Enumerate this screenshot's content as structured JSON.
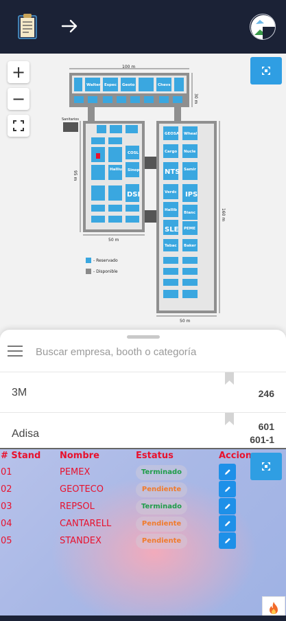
{
  "header": {
    "avatar_alt": ""
  },
  "map": {
    "plan": {
      "top_width": "100 m",
      "top_height": "30 m",
      "left_width": "50 m",
      "left_height": "95 m",
      "right_width": "50 m",
      "right_height": "160 m",
      "sanitarios": "Sanitarios",
      "legend_reservado": "- Reservado",
      "legend_disponible": "- Disponible",
      "top_labels": [
        "Walter",
        "Espec",
        "Geoto",
        "Chevs"
      ],
      "left_labels": [
        "COSL",
        "Halliu",
        "Sinop",
        "DSI"
      ],
      "right_labels": [
        "GEOSA",
        "Wheal",
        "Cargo",
        "Nucle",
        "NTS",
        "Samir",
        "Verdc",
        "IPS",
        "Hallib",
        "Bianc",
        "SLE",
        "PEME",
        "Tabac",
        "Baker"
      ]
    },
    "colors": {
      "reserved": "#3aa7e0",
      "available": "#8a8a8a"
    }
  },
  "search": {
    "placeholder": "Buscar empresa, booth o categoría"
  },
  "list": [
    {
      "name": "3M",
      "booths": [
        "246"
      ]
    },
    {
      "name": "Adisa",
      "booths": [
        "601",
        "601-1"
      ]
    }
  ],
  "table": {
    "headers": {
      "stand": "# Stand",
      "nombre": "Nombre",
      "estatus": "Estatus",
      "acciones": "Accion"
    },
    "rows": [
      {
        "stand": "01",
        "nombre": "PEMEX",
        "estatus": "Terminado",
        "status_color": "#1f9d49"
      },
      {
        "stand": "02",
        "nombre": "GEOTECO",
        "estatus": "Pendiente",
        "status_color": "#f07b2c"
      },
      {
        "stand": "03",
        "nombre": "REPSOL",
        "estatus": "Terminado",
        "status_color": "#1f9d49"
      },
      {
        "stand": "04",
        "nombre": "CANTARELL",
        "estatus": "Pendiente",
        "status_color": "#f07b2c"
      },
      {
        "stand": "05",
        "nombre": "STANDEX",
        "estatus": "Pendiente",
        "status_color": "#f07b2c"
      }
    ]
  },
  "icons": {
    "clipboard": "clipboard-icon",
    "arrow": "arrow-right-icon",
    "avatar": "avatar",
    "zoom_in": "plus-icon",
    "zoom_out": "minus-icon",
    "fullscreen": "fullscreen-icon",
    "expand": "expand-icon",
    "menu": "hamburger-icon",
    "edit": "pencil-icon",
    "fire": "fire-icon"
  }
}
